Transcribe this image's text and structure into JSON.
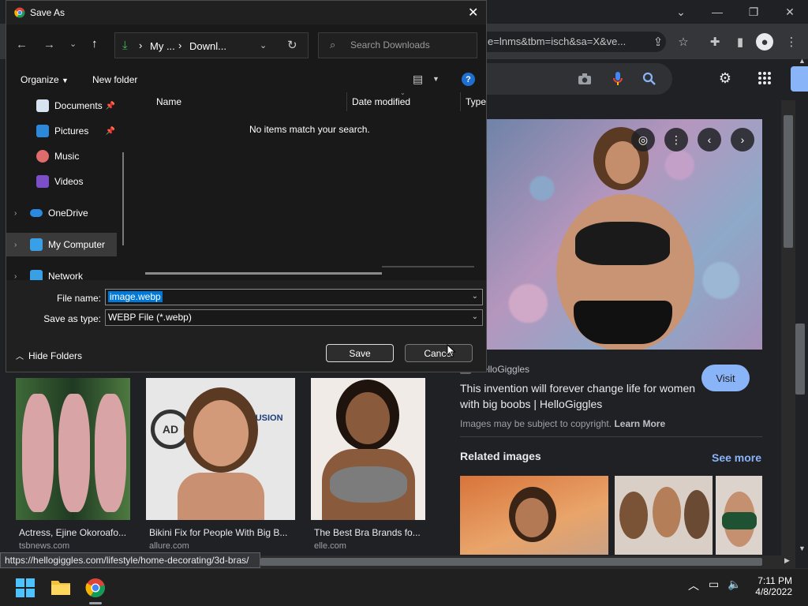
{
  "browser": {
    "address_text": "e=lnms&tbm=isch&sa=X&ve...",
    "status_url": "https://hellogiggles.com/lifestyle/home-decorating/3d-bras/"
  },
  "preview": {
    "source": "HelloGiggles",
    "visit_label": "Visit",
    "title": "This invention will forever change life for women with big boobs | HelloGiggles",
    "copyright_text": "Images may be subject to copyright.",
    "learn_more": "Learn More",
    "related_title": "Related images",
    "see_more": "See more"
  },
  "results": [
    {
      "caption": "Actress, Ejine Okoroafo...",
      "site": "tsbnews.com"
    },
    {
      "caption": "Bikini Fix for People With Big B...",
      "site": "allure.com"
    },
    {
      "caption": "The Best Bra Brands fo...",
      "site": "elle.com"
    }
  ],
  "thumb_text": {
    "logo1": "AD",
    "logo2": "FUSION"
  },
  "dialog": {
    "title": "Save As",
    "breadcrumb": [
      "My ...",
      "Downl..."
    ],
    "search_placeholder": "Search Downloads",
    "organize": "Organize",
    "new_folder": "New folder",
    "sidebar": [
      {
        "label": "Documents",
        "pinned": true
      },
      {
        "label": "Pictures",
        "pinned": true
      },
      {
        "label": "Music"
      },
      {
        "label": "Videos"
      },
      {
        "label": "OneDrive"
      },
      {
        "label": "My Computer"
      },
      {
        "label": "Network"
      }
    ],
    "columns": [
      "Name",
      "Date modified",
      "Type"
    ],
    "empty_text": "No items match your search.",
    "file_name_label": "File name:",
    "file_name_value": "image.webp",
    "save_type_label": "Save as type:",
    "save_type_value": "WEBP File (*.webp)",
    "hide_folders": "Hide Folders",
    "save_label": "Save",
    "cancel_label": "Cancel"
  },
  "taskbar": {
    "time": "7:11 PM",
    "date": "4/8/2022"
  },
  "colors": {
    "accent": "#8ab4f8",
    "selection": "#0078d7"
  }
}
